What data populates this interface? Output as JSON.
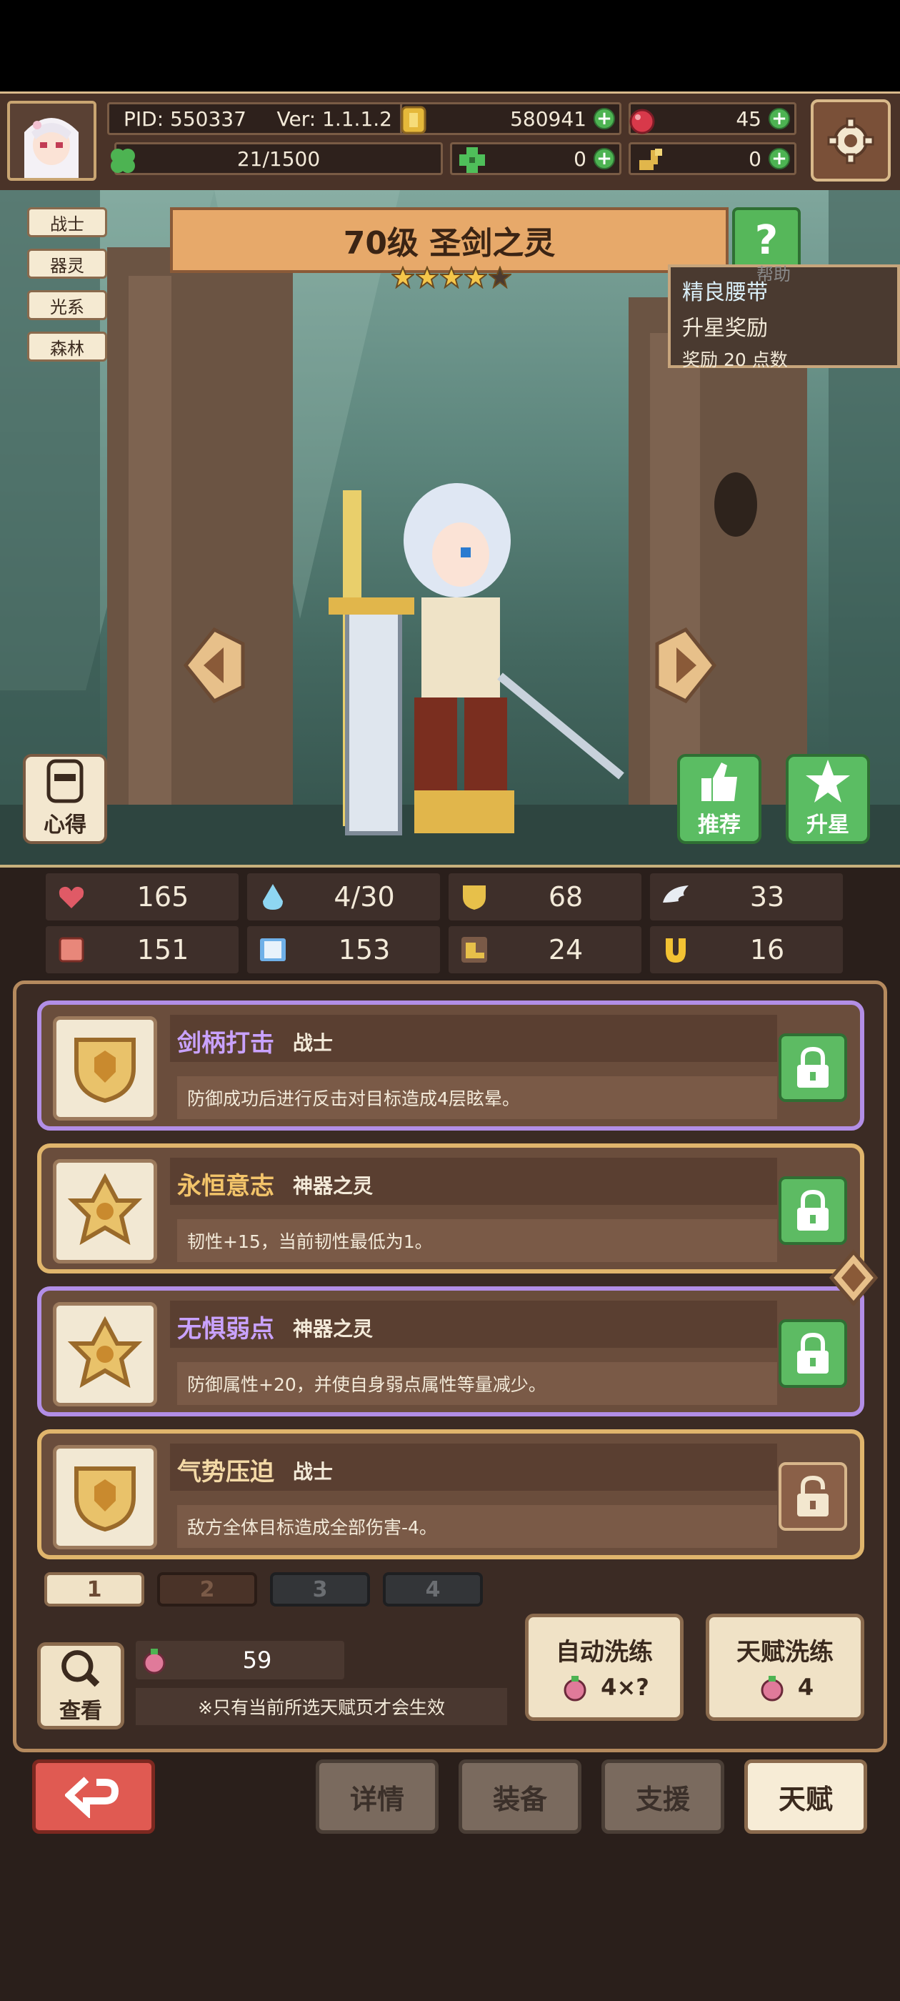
{
  "topbar": {
    "pid": "PID: 550337",
    "version": "Ver: 1.1.1.2",
    "gold": "580941",
    "gems": "45",
    "energy": "21/1500",
    "clover": "0",
    "key": "0"
  },
  "tags": [
    "战士",
    "器灵",
    "光系",
    "森林"
  ],
  "hero": {
    "title": "70级  圣剑之灵",
    "stars_filled": 4,
    "stars_total": 5,
    "help_symbol": "?",
    "help_label": "帮助"
  },
  "tooltip": {
    "line1": "精良腰带",
    "line2": "升星奖励",
    "line3": "奖励 20 点数"
  },
  "side_buttons": {
    "notes": "心得",
    "recommend": "推荐",
    "star_up": "升星"
  },
  "stats": [
    {
      "icon": "heart-icon",
      "value": "165",
      "color": "#e05a66"
    },
    {
      "icon": "drop-icon",
      "value": "4/30",
      "color": "#8ed6f2"
    },
    {
      "icon": "shield-icon",
      "value": "68",
      "color": "#e7c04a"
    },
    {
      "icon": "wing-icon",
      "value": "33",
      "color": "#e8ecf2"
    },
    {
      "icon": "fist-icon",
      "value": "151",
      "color": "#e8877a"
    },
    {
      "icon": "book-icon",
      "value": "153",
      "color": "#6fb0e8"
    },
    {
      "icon": "boot-icon",
      "value": "24",
      "color": "#e7c04a"
    },
    {
      "icon": "magnet-icon",
      "value": "16",
      "color": "#f2c233"
    }
  ],
  "skills": [
    {
      "name": "剑柄打击",
      "type": "战士",
      "desc": "防御成功后进行反击对目标造成4层眩晕。",
      "name_color": "#c9a2ff",
      "border": "#b28ee6",
      "lock": "locked-green",
      "emblem": "shield"
    },
    {
      "name": "永恒意志",
      "type": "神器之灵",
      "desc": "韧性+15，当前韧性最低为1。",
      "name_color": "#f3c46a",
      "border": "#e0b56c",
      "lock": "locked-green",
      "emblem": "crown"
    },
    {
      "name": "无惧弱点",
      "type": "神器之灵",
      "desc": "防御属性+20，并使自身弱点属性等量减少。",
      "name_color": "#c9a2ff",
      "border": "#b28ee6",
      "lock": "locked-green",
      "emblem": "crown"
    },
    {
      "name": "气势压迫",
      "type": "战士",
      "desc": "敌方全体目标造成全部伤害-4。",
      "name_color": "#f3d9a6",
      "border": "#e0b56c",
      "lock": "unlocked-brown",
      "emblem": "shield"
    }
  ],
  "pages": [
    "1",
    "2",
    "3",
    "4"
  ],
  "potion_count": "59",
  "note": "※只有当前所选天赋页才会生效",
  "view_label": "查看",
  "auto_refine": {
    "label": "自动洗练",
    "cost": "4×?"
  },
  "talent_refine": {
    "label": "天赋洗练",
    "cost": "4"
  },
  "nav": [
    "详情",
    "装备",
    "支援",
    "天赋"
  ]
}
